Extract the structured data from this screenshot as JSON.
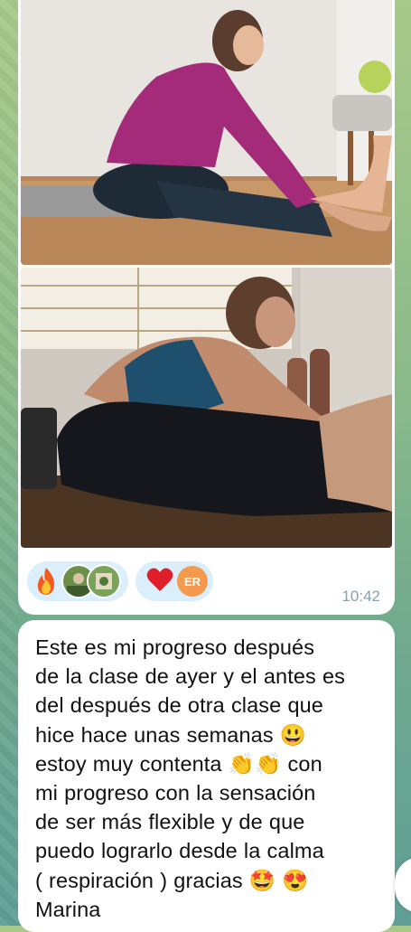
{
  "message_photos": {
    "time": "10:42",
    "reactions": [
      {
        "emoji": "fire-emoji",
        "users": [
          "avatar-1",
          "avatar-2"
        ]
      },
      {
        "emoji": "red-heart-emoji",
        "user_initials": "ER"
      }
    ]
  },
  "message_text": {
    "lines": [
      "Este es mi progreso después",
      "de la clase de ayer y el antes es",
      "del después de otra clase que",
      "hice hace unas semanas 😃",
      "estoy muy contenta 👏👏 con",
      "mi progreso con la sensación",
      "de ser más flexible y de que",
      "puedo lograrlo desde la calma",
      "( respiración ) gracias 🤩 😍",
      "Marina"
    ]
  },
  "colors": {
    "bubble": "#ffffff",
    "reaction_bg": "#dbeefb",
    "badge": "#f39a4f",
    "time": "#8aa0ae"
  }
}
